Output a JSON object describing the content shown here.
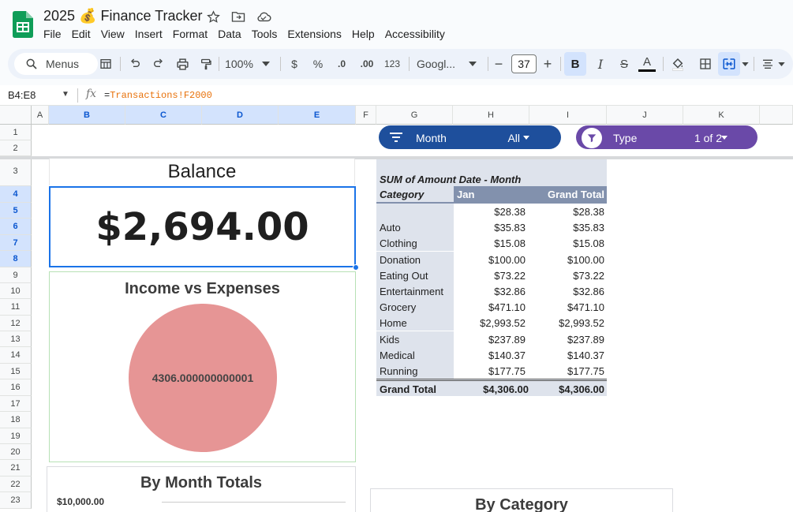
{
  "app": {
    "doc_title": "2025 💰 Finance Tracker",
    "menu": [
      "File",
      "Edit",
      "View",
      "Insert",
      "Format",
      "Data",
      "Tools",
      "Extensions",
      "Help",
      "Accessibility"
    ]
  },
  "toolbar": {
    "menus_label": "Menus",
    "zoom": "100%",
    "currency": "$",
    "percent": "%",
    "dec_decrease": ".0",
    "dec_increase": ".00",
    "format_123": "123",
    "font": "Googl...",
    "font_size": "37",
    "minus": "−",
    "plus": "+",
    "bold": "B",
    "italic": "I",
    "strike": "S",
    "text_color": "A"
  },
  "formula_bar": {
    "name_box": "B4:E8",
    "fx": "fx",
    "formula_prefix": "=",
    "formula_ref": "Transactions!F2000"
  },
  "grid": {
    "columns": [
      {
        "label": "A",
        "selected": false
      },
      {
        "label": "B",
        "selected": true
      },
      {
        "label": "C",
        "selected": true
      },
      {
        "label": "D",
        "selected": true
      },
      {
        "label": "E",
        "selected": true
      },
      {
        "label": "F",
        "selected": false
      },
      {
        "label": "G",
        "selected": false
      },
      {
        "label": "H",
        "selected": false
      },
      {
        "label": "I",
        "selected": false
      },
      {
        "label": "J",
        "selected": false
      },
      {
        "label": "K",
        "selected": false
      }
    ],
    "rows": [
      "1",
      "2",
      "3",
      "4",
      "5",
      "6",
      "7",
      "8",
      "9",
      "10",
      "11",
      "12",
      "13",
      "14",
      "15",
      "16",
      "17",
      "18",
      "19",
      "20",
      "21",
      "22",
      "23"
    ],
    "selected_rows": [
      "4",
      "5",
      "6",
      "7",
      "8"
    ]
  },
  "filters": {
    "month": {
      "label": "Month",
      "value": "All"
    },
    "type": {
      "label": "Type",
      "value": "1 of 2"
    }
  },
  "balance": {
    "title": "Balance",
    "value": "$2,694.00"
  },
  "income_chart": {
    "title": "Income vs Expenses",
    "slice_label": "4306.000000000001",
    "slice_color": "#e69595"
  },
  "pivot": {
    "title": "SUM of Amount Date - Month",
    "row_header": "Category",
    "col_jan": "Jan",
    "col_total": "Grand Total",
    "rows": [
      {
        "category": "",
        "jan": "$28.38",
        "total": "$28.38"
      },
      {
        "category": "Auto",
        "jan": "$35.83",
        "total": "$35.83"
      },
      {
        "category": "Clothing",
        "jan": "$15.08",
        "total": "$15.08"
      },
      {
        "category": "Donation",
        "jan": "$100.00",
        "total": "$100.00"
      },
      {
        "category": "Eating Out",
        "jan": "$73.22",
        "total": "$73.22"
      },
      {
        "category": "Entertainment",
        "jan": "$32.86",
        "total": "$32.86"
      },
      {
        "category": "Grocery",
        "jan": "$471.10",
        "total": "$471.10"
      },
      {
        "category": "Home",
        "jan": "$2,993.52",
        "total": "$2,993.52"
      },
      {
        "category": "Kids",
        "jan": "$237.89",
        "total": "$237.89"
      },
      {
        "category": "Medical",
        "jan": "$140.37",
        "total": "$140.37"
      },
      {
        "category": "Running",
        "jan": "$177.75",
        "total": "$177.75"
      }
    ],
    "grand_total_label": "Grand Total",
    "grand_total_jan": "$4,306.00",
    "grand_total": "$4,306.00"
  },
  "month_chart": {
    "title": "By Month Totals",
    "first_tick": "$10,000.00"
  },
  "category_chart": {
    "title": "By Category"
  },
  "colors": {
    "month_chip": "#1e4f9c",
    "type_chip": "#6a49a8",
    "selection": "#1a73e8"
  }
}
